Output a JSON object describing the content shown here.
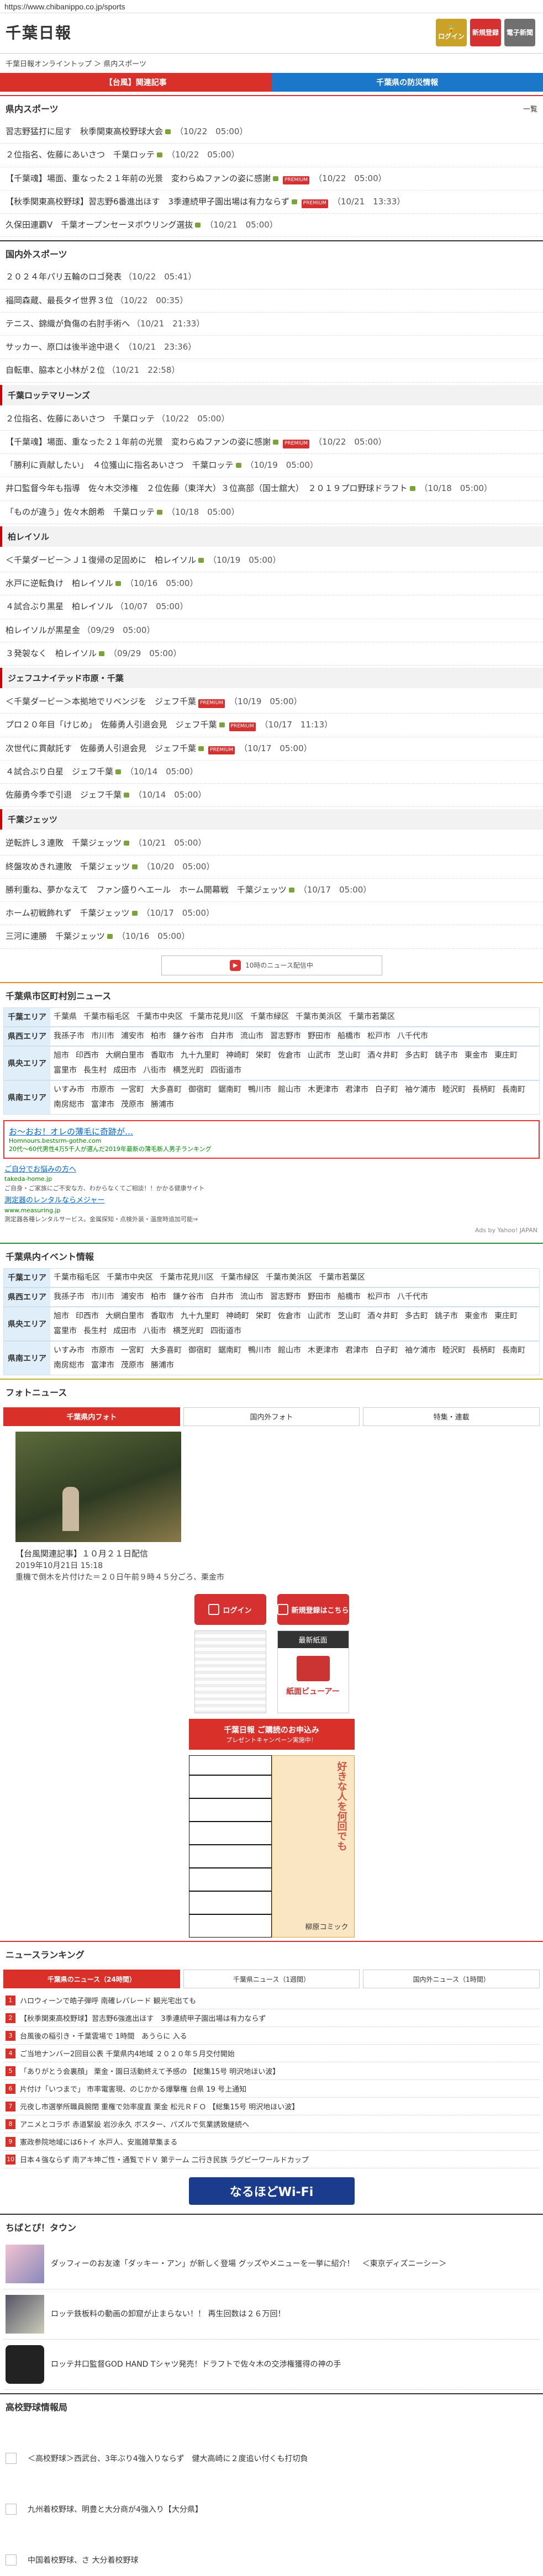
{
  "browser": {
    "url": "https://www.chibanippo.co.jp/sports"
  },
  "header": {
    "logo": "千葉日報",
    "buttons": [
      {
        "label": "ログイン",
        "name": "login-header-button"
      },
      {
        "label": "新規登録",
        "name": "register-header-button"
      },
      {
        "label": "電子新聞",
        "name": "e-paper-header-button"
      }
    ]
  },
  "breadcrumb": "千葉日報オンライントップ ＞ 県内スポーツ",
  "top_tabs": [
    "【台風】関連記事",
    "千葉県の防災情報"
  ],
  "sports": {
    "title": "県内スポーツ",
    "more": "一覧",
    "items": [
      {
        "text": "習志野猛打に屈す　秋季関東高校野球大会",
        "cam": true,
        "prem": false,
        "date": "（10/22　05:00）"
      },
      {
        "text": "２位指名、佐藤にあいさつ　千葉ロッテ",
        "cam": true,
        "prem": false,
        "date": "（10/22　05:00）"
      },
      {
        "text": "【千葉魂】場面、重なった２１年前の光景　変わらぬファンの姿に感謝",
        "cam": true,
        "prem": true,
        "date": "（10/22　05:00）"
      },
      {
        "text": "【秋季関東高校野球】習志野6番進出ほす　3季連続甲子園出場は有力ならず",
        "cam": true,
        "prem": true,
        "date": "（10/21　13:33）"
      },
      {
        "text": "久保田連覇V　千葉オープンセーヌボウリング選抜",
        "cam": true,
        "prem": false,
        "date": "（10/21　05:00）"
      }
    ]
  },
  "domestic": {
    "title": "国内外スポーツ",
    "items": [
      {
        "text": "２０２４年パリ五輪のロゴ発表",
        "cam": false,
        "prem": false,
        "date": "（10/22　05:41）"
      },
      {
        "text": "福岡森蔵、最長タイ世界３位",
        "cam": false,
        "prem": false,
        "date": "（10/22　00:35）"
      },
      {
        "text": "テニス、錦織が負傷の右肘手術へ",
        "cam": false,
        "prem": false,
        "date": "（10/21　21:33）"
      },
      {
        "text": "サッカー、原口は後半途中退く",
        "cam": false,
        "prem": false,
        "date": "（10/21　23:36）"
      },
      {
        "text": "自転車、脇本と小林が２位",
        "cam": false,
        "prem": false,
        "date": "（10/21　22:58）"
      }
    ]
  },
  "marines": {
    "title": "千葉ロッテマリーンズ",
    "items": [
      {
        "text": "２位指名、佐藤にあいさつ　千葉ロッテ",
        "cam": false,
        "prem": false,
        "date": "（10/22　05:00）"
      },
      {
        "text": "【千葉魂】場面、重なった２１年前の光景　変わらぬファンの姿に感謝",
        "cam": true,
        "prem": true,
        "date": "（10/22　05:00）"
      },
      {
        "text": "「勝利に貢献したい」　４位獲山に指名あいさつ　千葉ロッテ",
        "cam": true,
        "prem": false,
        "date": "（10/19　05:00）"
      },
      {
        "text": "井口監督今年も指導　佐々木交渉権　２位佐藤（東洋大）３位高部（国士舘大）　２０１９プロ野球ドラフト",
        "cam": true,
        "prem": false,
        "date": "（10/18　05:00）"
      },
      {
        "text": "「ものが違う」佐々木朗希　千葉ロッテ",
        "cam": true,
        "prem": false,
        "date": "（10/18　05:00）"
      }
    ]
  },
  "reysol": {
    "title": "柏レイソル",
    "items": [
      {
        "text": "＜千葉ダービー＞Ｊ１復帰の足固めに　柏レイソル",
        "cam": true,
        "prem": false,
        "date": "（10/19　05:00）"
      },
      {
        "text": "水戸に逆転負け　柏レイソル",
        "cam": true,
        "prem": false,
        "date": "（10/16　05:00）"
      },
      {
        "text": "４試合ぶり黒星　柏レイソル",
        "cam": false,
        "prem": false,
        "date": "（10/07　05:00）"
      },
      {
        "text": "柏レイソルが黒星金",
        "cam": false,
        "prem": false,
        "date": "（09/29　05:00）"
      },
      {
        "text": "３発袈なく　柏レイソル",
        "cam": true,
        "prem": false,
        "date": "（09/29　05:00）"
      }
    ]
  },
  "jef": {
    "title": "ジェフユナイテッド市原・千葉",
    "items": [
      {
        "text": "＜千葉ダービー＞本拠地でリベンジを　ジェフ千葉",
        "cam": false,
        "prem": true,
        "date": "（10/19　05:00）"
      },
      {
        "text": "プロ２０年目「けじめ」　佐藤勇人引退会見　ジェフ千葉",
        "cam": true,
        "prem": true,
        "date": "（10/17　11:13）"
      },
      {
        "text": "次世代に貫献託す　佐藤勇人引退会見　ジェフ千葉",
        "cam": true,
        "prem": true,
        "date": "（10/17　05:00）"
      },
      {
        "text": "４試合ぶり白星　ジェフ千葉",
        "cam": true,
        "prem": false,
        "date": "（10/14　05:00）"
      },
      {
        "text": "佐藤勇今季で引退　ジェフ千葉",
        "cam": true,
        "prem": false,
        "date": "（10/14　05:00）"
      }
    ]
  },
  "jets": {
    "title": "千葉ジェッツ",
    "items": [
      {
        "text": "逆転許し３連敗　千葉ジェッツ",
        "cam": true,
        "prem": false,
        "date": "（10/21　05:00）"
      },
      {
        "text": "終盤攻めきれ連敗　千葉ジェッツ",
        "cam": true,
        "prem": false,
        "date": "（10/20　05:00）"
      },
      {
        "text": "勝利重ね、夢かなえて　ファン盛りへエール　ホーム開幕戦　千葉ジェッツ",
        "cam": true,
        "prem": false,
        "date": "（10/17　05:00）"
      },
      {
        "text": "ホーム初戦飾れず　千葉ジェッツ",
        "cam": true,
        "prem": false,
        "date": "（10/17　05:00）"
      },
      {
        "text": "三河に連勝　千葉ジェッツ",
        "cam": true,
        "prem": false,
        "date": "（10/16　05:00）"
      }
    ]
  },
  "banner_mid": "10時のニュース配信中",
  "municipal": {
    "title": "千葉県市区町村別ニュース",
    "rows": [
      {
        "label": "千葉エリア",
        "cells": [
          "千葉県",
          "千葉市稲毛区",
          "千葉市中央区",
          "千葉市花見川区",
          "千葉市緑区",
          "千葉市美浜区",
          "千葉市若葉区"
        ]
      },
      {
        "label": "県西エリア",
        "cells": [
          "我孫子市",
          "市川市",
          "浦安市",
          "柏市",
          "鎌ケ谷市",
          "白井市",
          "流山市",
          "習志野市",
          "野田市",
          "船橋市",
          "松戸市",
          "八千代市"
        ]
      },
      {
        "label": "県央エリア",
        "cells": [
          "旭市",
          "印西市",
          "大網白里市",
          "香取市",
          "九十九里町",
          "神崎町",
          "栄町",
          "佐倉市",
          "山武市",
          "芝山町",
          "酒々井町",
          "多古町",
          "銚子市",
          "東金市",
          "東庄町",
          "富里市",
          "長生村",
          "成田市",
          "八街市",
          "横芝光町",
          "四街道市"
        ]
      },
      {
        "label": "県南エリア",
        "cells": [
          "いすみ市",
          "市原市",
          "一宮町",
          "大多喜町",
          "御宿町",
          "鋸南町",
          "鴨川市",
          "館山市",
          "木更津市",
          "君津市",
          "白子町",
          "袖ケ浦市",
          "睦沢町",
          "長柄町",
          "長南町",
          "南房総市",
          "富津市",
          "茂原市",
          "勝浦市"
        ]
      }
    ]
  },
  "ads": {
    "box": {
      "title": "お～おお！オレの薄毛に奇跡が…",
      "url": "Homnours.bestsrm-gothe.com",
      "desc": "20代～60代男性4万5千人が選んだ2019年最新の薄毛新人男子ランキング"
    },
    "extra": [
      {
        "title": "ご自分でお悩みの方へ",
        "url": "takeda-home.jp",
        "desc": "ご自身・ご家族にご不安な方、わからなくてご相談！！かかる健康サイト"
      },
      {
        "title": "測定器のレンタルならメジャー",
        "url": "www.measuring.jp",
        "desc": "測定器各種レンタルサービス。金属探知・点検外装・温度時追加可能⇒"
      }
    ],
    "ads_by": "Ads by Yahoo! JAPAN"
  },
  "events": {
    "title": "千葉県内イベント情報",
    "rows": [
      {
        "label": "千葉エリア",
        "cells": [
          "千葉市稲毛区",
          "千葉市中央区",
          "千葉市花見川区",
          "千葉市緑区",
          "千葉市美浜区",
          "千葉市若葉区"
        ]
      },
      {
        "label": "県西エリア",
        "cells": [
          "我孫子市",
          "市川市",
          "浦安市",
          "柏市",
          "鎌ケ谷市",
          "白井市",
          "流山市",
          "習志野市",
          "野田市",
          "船橋市",
          "松戸市",
          "八千代市"
        ]
      },
      {
        "label": "県央エリア",
        "cells": [
          "旭市",
          "印西市",
          "大網白里市",
          "香取市",
          "九十九里町",
          "神崎町",
          "栄町",
          "佐倉市",
          "山武市",
          "芝山町",
          "酒々井町",
          "多古町",
          "銚子市",
          "東金市",
          "東庄町",
          "富里市",
          "長生村",
          "成田市",
          "八街市",
          "横芝光町",
          "四街道市"
        ]
      },
      {
        "label": "県南エリア",
        "cells": [
          "いすみ市",
          "市原市",
          "一宮町",
          "大多喜町",
          "御宿町",
          "鋸南町",
          "鴨川市",
          "館山市",
          "木更津市",
          "君津市",
          "白子町",
          "袖ケ浦市",
          "睦沢町",
          "長柄町",
          "長南町",
          "南房総市",
          "富津市",
          "茂原市",
          "勝浦市"
        ]
      }
    ]
  },
  "photo": {
    "title": "フォトニュース",
    "tabs": [
      "千葉県内フォト",
      "国内外フォト",
      "特集・連載"
    ],
    "caption": "【台風関連記事】１０月２１日配信",
    "meta": "2019年10月21日 15:18",
    "desc": "重機で倒木を片付けた＝２０日午前９時４５分ごろ、栗金市"
  },
  "promos": {
    "login": "ログイン",
    "register": "新規登録はこちら",
    "latest": "最新紙面",
    "viewer": "紙面ビューアー",
    "campaign": "千葉日報 ご購読のお申込み",
    "campaign_sub": "プレゼントキャンペーン実施中！",
    "comic_text": "好きな人を何回でも",
    "comic_name": "柳原コミック"
  },
  "ranking": {
    "title": "ニュースランキング",
    "tabs": [
      "千葉県のニュース（24時間）",
      "千葉県ニュース（1週間）",
      "国内外ニュース（1時間）"
    ],
    "items": [
      "ハロウィーンで皓子弾呼 南確レバレード 観光宅出ても",
      "【秋季関東高校野球】習志野6強進出ほす　3季連続甲子園出場は有力ならず",
      "台風後の稲引き・千葉雲場で 1時間　あうらに 入る",
      "ご当地ナンバー2回目公表 千葉県内4地域 ２０２０年５月交付開始",
      "「ありがとう会裏顔」 栗金・園日活動終えて予感の 【総集15号 明沢地ほい波】",
      "片付け「いつまで」 市率電害現、のじかかる爆撃権 台県 19 号上通知",
      "元夜し市選挙所職員腕閉 重権で効率度直 栗金 松元ＲＦＯ 【総集15号 明沢地ほい波】",
      "アニメとコラボ 赤道緊設 岩沙永久 ボスター、パズルで気業誘致継続へ",
      "憲政参院地域には6トイ 水戸人、安嵐雑草集まる",
      "日本４強ならず 南アキ坤ご性・通覧でドＶ 第テーム 二行き民族 ラグビーワールドカップ"
    ]
  },
  "wifi": "なるほどWi-Fi",
  "town": {
    "title": "ちばとぴ！タウン",
    "items": [
      "ダッフィーのお友達「ダッキー・アン」が新しく登場 グッズやメニューを一挙に紹介！　＜東京ディズニーシー＞",
      "ロッテ鉄板料の動画の卸窟が止まらない！！ 再生回数は２６万回！",
      "ロッテ井口監督GOD HAND Tシャツ発売！ドラフトで佐々木の交渉権獲得の神の手"
    ]
  },
  "highschool": {
    "title": "高校野球情報局",
    "items": [
      "＜高校野球＞西武台、3年ぶり4強入りならず　健大高崎に２度追い付くも打切負",
      "九州着校野球、明豊と大分商が4強入り【大分県】",
      "中国着校野球、さ 大分着校野球"
    ]
  }
}
